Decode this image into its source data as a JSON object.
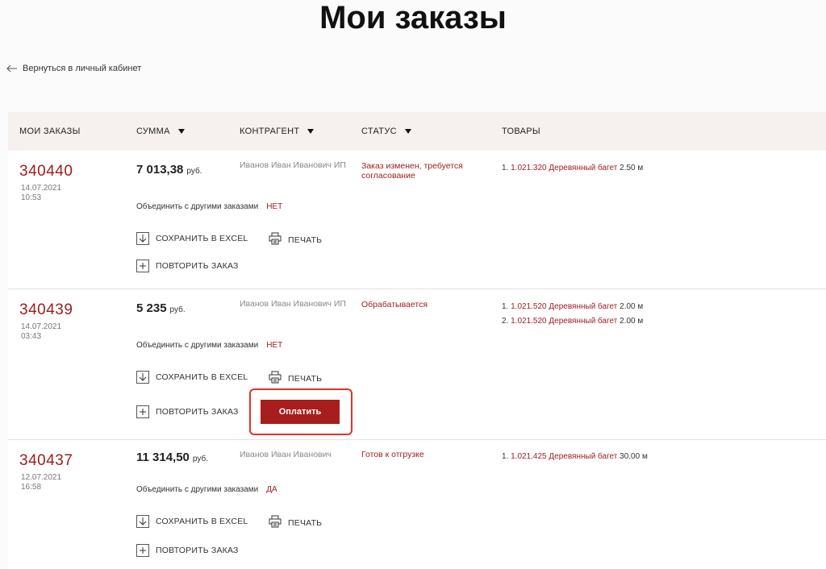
{
  "page": {
    "title": "Мои заказы",
    "back_label": "Вернуться в личный кабинет"
  },
  "table": {
    "headers": {
      "orders": "МОИ ЗАКАЗЫ",
      "sum": "СУММА",
      "contractor": "КОНТРАГЕНТ",
      "status": "СТАТУС",
      "goods": "ТОВАРЫ"
    }
  },
  "labels": {
    "merge": "Объединить с другими заказами",
    "save_excel": "СОХРАНИТЬ В EXCEL",
    "print": "ПЕЧАТЬ",
    "repeat": "ПОВТОРИТЬ ЗАКАЗ",
    "currency": "руб.",
    "pay": "Оплатить"
  },
  "orders": [
    {
      "number": "340440",
      "date": "14.07.2021",
      "time": "10:53",
      "sum": "7 013,38",
      "contractor": "Иванов Иван Иванович ИП",
      "status": "Заказ изменен, требуется согласование",
      "merge_value": "НЕТ",
      "goods": [
        {
          "idx": "1.",
          "code": "1.021.320 Деревянный багет",
          "qty": "2.50 м"
        }
      ]
    },
    {
      "number": "340439",
      "date": "14.07.2021",
      "time": "03:43",
      "sum": "5 235",
      "contractor": "Иванов Иван Иванович ИП",
      "status": "Обрабатывается",
      "merge_value": "НЕТ",
      "goods": [
        {
          "idx": "1.",
          "code": "1.021.520 Деревянный багет",
          "qty": "2.00 м"
        },
        {
          "idx": "2.",
          "code": "1.021.520 Деревянный багет",
          "qty": "2.00 м"
        }
      ]
    },
    {
      "number": "340437",
      "date": "12.07.2021",
      "time": "16:58",
      "sum": "11 314,50",
      "contractor": "Иванов Иван Иванович",
      "status": "Готов к отгрузке",
      "merge_value": "ДА",
      "goods": [
        {
          "idx": "1.",
          "code": "1.021.425 Деревянный багет",
          "qty": "30.00 м"
        }
      ]
    }
  ],
  "colors": {
    "accent": "#9e1b1b",
    "pay_button": "#a81d1d",
    "highlight": "#e0332c",
    "header_bg": "#f6f1ee"
  }
}
